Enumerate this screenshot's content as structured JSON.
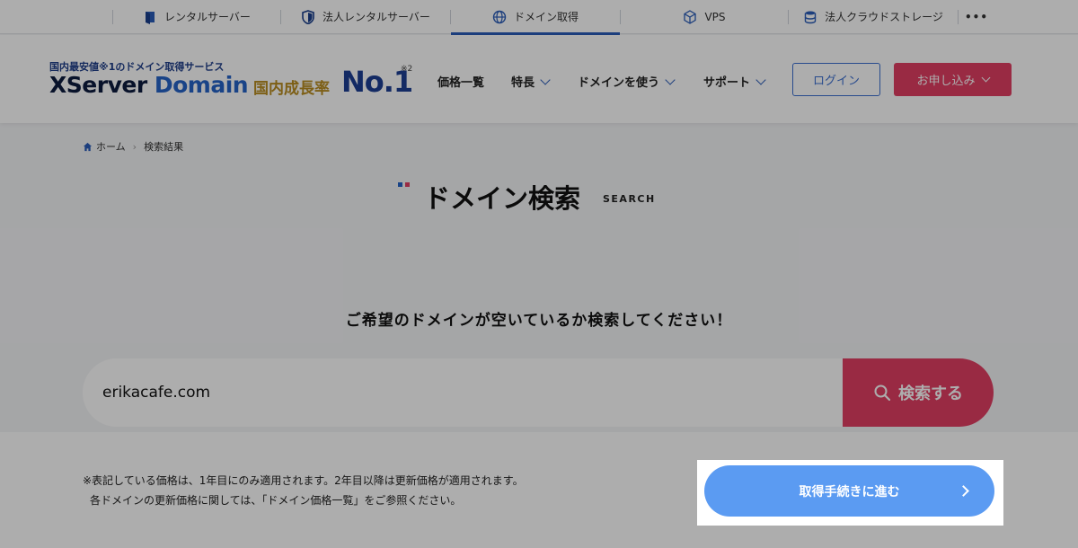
{
  "topbar": {
    "tabs": [
      {
        "label": "レンタルサーバー",
        "icon": "rental-server-icon"
      },
      {
        "label": "法人レンタルサーバー",
        "icon": "shield-icon"
      },
      {
        "label": "ドメイン取得",
        "icon": "globe-icon",
        "active": true
      },
      {
        "label": "VPS",
        "icon": "cube-icon"
      },
      {
        "label": "法人クラウドストレージ",
        "icon": "database-icon"
      }
    ],
    "more": "•••"
  },
  "header": {
    "logo_tagline": "国内最安値※1のドメイン取得サービス",
    "logo_main_1": "XServer",
    "logo_main_2": "Domain",
    "rank_label": "国内成長率",
    "rank_value": "No.1",
    "rank_note": "※2",
    "nav": [
      "価格一覧",
      "特長",
      "ドメインを使う",
      "サポート"
    ],
    "login": "ログイン",
    "apply": "お申し込み"
  },
  "breadcrumb": [
    "ホーム",
    "検索結果"
  ],
  "page": {
    "title": "ドメイン検索",
    "subtitle": "SEARCH",
    "lead": "ご希望のドメインが空いているか検索してください！"
  },
  "search": {
    "value": "erikacafe.com",
    "button": "検索する"
  },
  "note": {
    "line1": "※表記している価格は、1年目にのみ適用されます。2年目以降は更新価格が適用されます。",
    "line2": "各ドメインの更新価格に関しては、「ドメイン価格一覧」をご参照ください。"
  },
  "proceed": "取得手続きに進む",
  "colors": {
    "accent": "#e23e63",
    "primary_blue": "#2563c8",
    "proceed_blue": "#5b9bf2"
  }
}
